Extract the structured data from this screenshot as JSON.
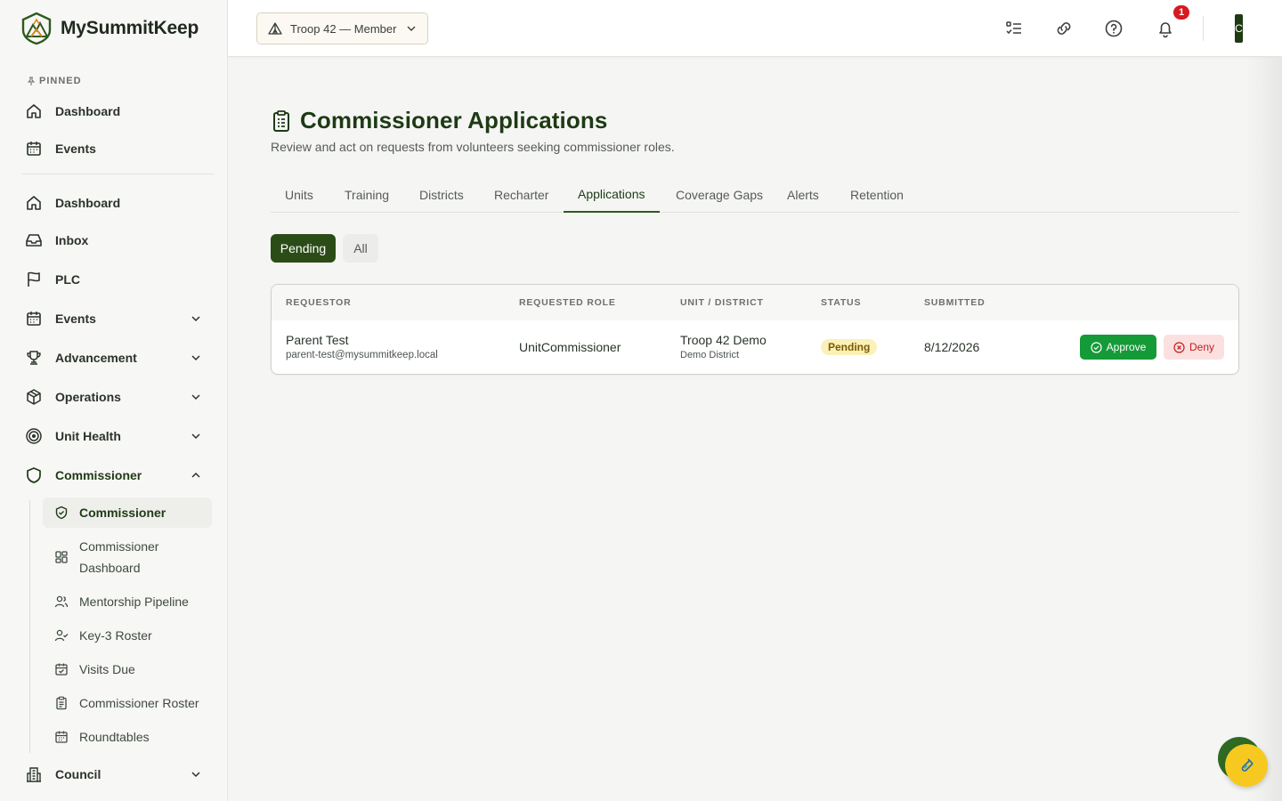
{
  "app": {
    "name": "MySummitKeep"
  },
  "sidebar": {
    "pinned_label": "PINNED",
    "pinned": [
      {
        "label": "Dashboard",
        "icon": "home-icon"
      },
      {
        "label": "Events",
        "icon": "calendar-icon"
      }
    ],
    "items": [
      {
        "label": "Dashboard",
        "icon": "home-icon"
      },
      {
        "label": "Inbox",
        "icon": "inbox-icon"
      },
      {
        "label": "PLC",
        "icon": "flag-icon"
      },
      {
        "label": "Events",
        "icon": "calendar-icon",
        "expandable": true
      },
      {
        "label": "Advancement",
        "icon": "trophy-icon",
        "expandable": true
      },
      {
        "label": "Operations",
        "icon": "package-icon",
        "expandable": true
      },
      {
        "label": "Unit Health",
        "icon": "target-icon",
        "expandable": true
      },
      {
        "label": "Commissioner",
        "icon": "shield-icon",
        "expandable": true,
        "expanded": true
      },
      {
        "label": "Council",
        "icon": "building-icon",
        "expandable": true
      }
    ],
    "commissioner_sub": [
      {
        "label": "Commissioner",
        "icon": "shield-check-icon",
        "active": true
      },
      {
        "label": "Commissioner Dashboard",
        "icon": "grid-icon"
      },
      {
        "label": "Mentorship Pipeline",
        "icon": "users-icon"
      },
      {
        "label": "Key-3 Roster",
        "icon": "user-check-icon"
      },
      {
        "label": "Visits Due",
        "icon": "calendar-check-icon"
      },
      {
        "label": "Commissioner Roster",
        "icon": "clipboard-icon"
      },
      {
        "label": "Roundtables",
        "icon": "calendar-grid-icon"
      }
    ]
  },
  "topbar": {
    "unit_selector": "Troop 42 — Member",
    "notification_count": "1",
    "avatar_initial": "C"
  },
  "page": {
    "title": "Commissioner Applications",
    "subtitle": "Review and act on requests from volunteers seeking commissioner roles.",
    "tabs": [
      "Units",
      "Training",
      "Districts",
      "Recharter",
      "Applications",
      "Coverage Gaps",
      "Alerts",
      "Retention"
    ],
    "active_tab": "Applications",
    "filters": {
      "pending": "Pending",
      "all": "All"
    }
  },
  "table": {
    "headers": {
      "requestor": "REQUESTOR",
      "role": "REQUESTED ROLE",
      "unit": "UNIT / DISTRICT",
      "status": "STATUS",
      "submitted": "SUBMITTED"
    },
    "rows": [
      {
        "name": "Parent Test",
        "email": "parent-test@mysummitkeep.local",
        "role": "UnitCommissioner",
        "unit": "Troop 42 Demo",
        "district": "Demo District",
        "status": "Pending",
        "submitted": "8/12/2026",
        "approve": "Approve",
        "deny": "Deny"
      }
    ]
  },
  "colors": {
    "brand_green": "#1e3a14",
    "approve": "#159a38",
    "deny_bg": "#fbe0e0",
    "pending_chip": "#fbf0b8",
    "badge_red": "#d71920"
  }
}
